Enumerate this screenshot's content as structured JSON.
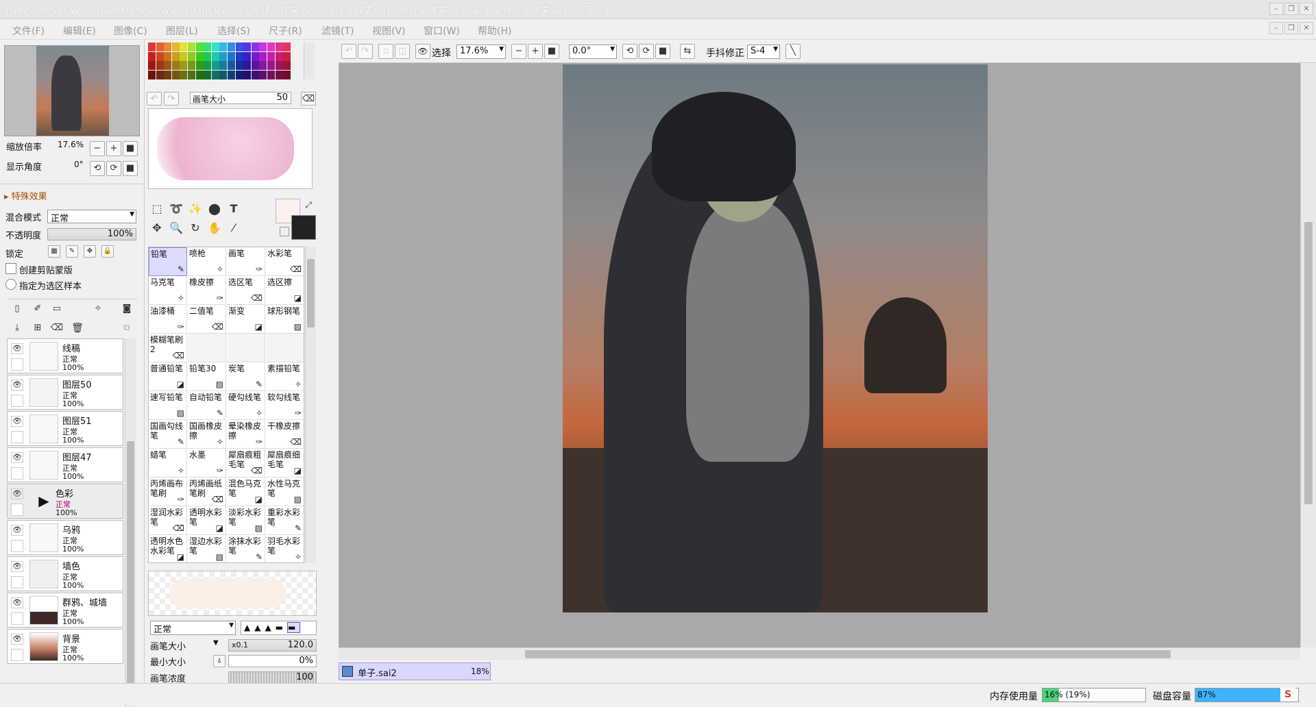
{
  "title": "PaintTool SAI Ver.2 (64bit) Preview.2019.08.07 - 3 / 新建文件夹 (2) / 新建文件夹 (3) / 新建文件夹 (7) - 副本 / 新建文件夹 (2) / 单子.sai2",
  "menu": [
    "文件(F)",
    "编辑(E)",
    "图像(C)",
    "图层(L)",
    "选择(S)",
    "尺子(R)",
    "滤镜(T)",
    "视图(V)",
    "窗口(W)",
    "帮助(H)"
  ],
  "navigator": {
    "zoom_label": "缩放倍率",
    "zoom_value": "17.6%",
    "angle_label": "显示角度",
    "angle_value": "0°"
  },
  "effects_label": "特殊效果",
  "blend": {
    "label": "混合模式",
    "value": "正常"
  },
  "opacity": {
    "label": "不透明度",
    "value": "100%"
  },
  "lock_label": "锁定",
  "clip_label": "创建剪贴蒙版",
  "sample_label": "指定为选区样本",
  "layers": [
    {
      "name": "线稿",
      "mode": "正常",
      "opacity": "100%"
    },
    {
      "name": "图层50",
      "mode": "正常",
      "opacity": "100%"
    },
    {
      "name": "图层51",
      "mode": "正常",
      "opacity": "100%"
    },
    {
      "name": "图层47",
      "mode": "正常",
      "opacity": "100%"
    },
    {
      "name": "色彩",
      "mode": "正常",
      "opacity": "100%"
    },
    {
      "name": "乌鸦",
      "mode": "正常",
      "opacity": "100%"
    },
    {
      "name": "墙色",
      "mode": "正常",
      "opacity": "100%"
    },
    {
      "name": "群鸦、城墙",
      "mode": "正常",
      "opacity": "100%"
    },
    {
      "name": "背景",
      "mode": "正常",
      "opacity": "100%"
    }
  ],
  "brush_size_top": {
    "label": "画笔大小",
    "value": "50"
  },
  "brushes": [
    [
      "铅笔",
      "喷枪",
      "画笔",
      "水彩笔"
    ],
    [
      "马克笔",
      "橡皮擦",
      "选区笔",
      "选区擦"
    ],
    [
      "油漆桶",
      "二值笔",
      "渐变",
      "球形钢笔"
    ],
    [
      "模糊笔刷2",
      "",
      "",
      ""
    ],
    [
      "普通铅笔",
      "铅笔30",
      "炭笔",
      "素描铅笔"
    ],
    [
      "速写铅笔",
      "自动铅笔",
      "硬勾线笔",
      "软勾线笔"
    ],
    [
      "国画勾线笔",
      "国画橡皮擦",
      "晕染橡皮擦",
      "干橡皮擦"
    ],
    [
      "蜡笔",
      "水墨",
      "犀扇痕粗毛笔",
      "犀扇痕细毛笔"
    ],
    [
      "丙烯画布笔刷",
      "丙烯画纸笔刷",
      "混色马克笔",
      "水性马克笔"
    ],
    [
      "湿润水彩笔",
      "透明水彩笔",
      "淡彩水彩笔",
      "重彩水彩笔"
    ],
    [
      "透明水色水彩笔",
      "湿边水彩笔",
      "涂抹水彩笔",
      "羽毛水彩笔"
    ]
  ],
  "brush_mode": "正常",
  "brush_props": [
    {
      "label": "画笔大小",
      "extra": "x0.1",
      "value": "120.0"
    },
    {
      "label": "最小大小",
      "value": "0%"
    },
    {
      "label": "画笔浓度",
      "value": "100"
    }
  ],
  "toolbar": {
    "select_label": "选择",
    "zoom": "17.6%",
    "angle": "0.0°",
    "stab_label": "手抖修正",
    "stab_value": "S-4"
  },
  "doc_tab": {
    "name": "单子.sai2",
    "zoom": "18%"
  },
  "status": {
    "mem_label": "内存使用量",
    "mem_value": "16% (19%)",
    "mem_fill": 0.16,
    "disk_label": "磁盘容量",
    "disk_value": "87%",
    "disk_fill": 0.87
  },
  "colors": {
    "accent": "#4f8cff",
    "selected_brush": "#dcdcff",
    "canvas_bg": "#a9a9a9"
  }
}
